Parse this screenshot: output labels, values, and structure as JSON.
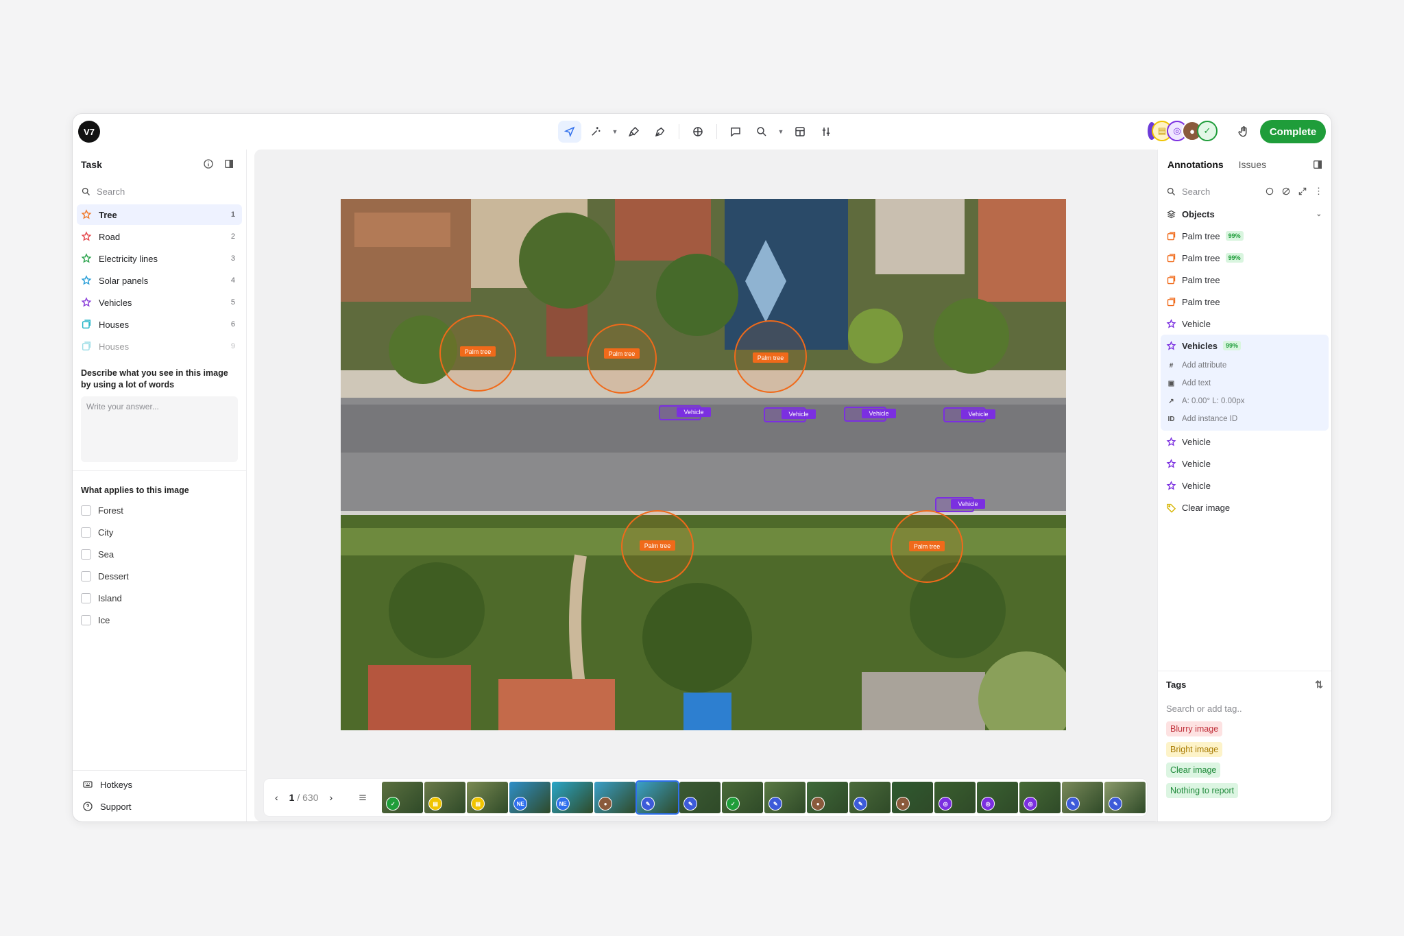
{
  "app": {
    "logo_text": "V7",
    "complete_label": "Complete"
  },
  "toolbar": {
    "tools": [
      {
        "name": "select-tool",
        "icon": "cursor-icon",
        "active": true
      },
      {
        "name": "auto-annotate-tool",
        "icon": "sparkle-icon"
      },
      {
        "name": "brush-tool",
        "icon": "brush-icon"
      },
      {
        "name": "pen-tool",
        "icon": "pen-icon"
      },
      {
        "name": "model-tool",
        "icon": "brain-icon"
      },
      {
        "name": "comment-tool",
        "icon": "comment-icon"
      },
      {
        "name": "zoom-tool",
        "icon": "zoom-icon"
      },
      {
        "name": "layout-tool",
        "icon": "layout-icon"
      },
      {
        "name": "adjust-tool",
        "icon": "sliders-icon"
      }
    ]
  },
  "left": {
    "title": "Task",
    "search_placeholder": "Search",
    "classes": [
      {
        "label": "Tree",
        "count": "1",
        "color": "#f07a2a",
        "selected": true
      },
      {
        "label": "Road",
        "count": "2",
        "color": "#e5484d"
      },
      {
        "label": "Electricity lines",
        "count": "3",
        "color": "#2ea44f"
      },
      {
        "label": "Solar panels",
        "count": "4",
        "color": "#2a9fd8"
      },
      {
        "label": "Vehicles",
        "count": "5",
        "color": "#8b3fd9"
      },
      {
        "label": "Houses",
        "count": "6",
        "color": "#27b6c9"
      },
      {
        "label": "Houses",
        "count": "9",
        "color": "#27b6c9",
        "faded": true
      }
    ],
    "question1": "Describe what you see in this image by using a lot of words",
    "answer_placeholder": "Write your answer...",
    "question2": "What applies to this image",
    "options": [
      "Forest",
      "City",
      "Sea",
      "Dessert",
      "Island",
      "Ice"
    ],
    "footer": [
      {
        "label": "Hotkeys",
        "icon": "keyboard-icon"
      },
      {
        "label": "Support",
        "icon": "help-icon"
      }
    ]
  },
  "canvas": {
    "labels": {
      "palm": "Palm tree",
      "vehicle": "Vehicle"
    },
    "pager": {
      "current": "1",
      "total": "/ 630"
    }
  },
  "right": {
    "tabs": [
      "Annotations",
      "Issues"
    ],
    "search_placeholder": "Search",
    "objects_label": "Objects",
    "annotations": [
      {
        "label": "Palm tree",
        "pct": "99%",
        "kind": "palm"
      },
      {
        "label": "Palm tree",
        "pct": "99%",
        "kind": "palm"
      },
      {
        "label": "Palm tree",
        "kind": "palm"
      },
      {
        "label": "Palm tree",
        "kind": "palm"
      },
      {
        "label": "Vehicle",
        "kind": "vehicle"
      }
    ],
    "selected": {
      "label": "Vehicles",
      "pct": "99%",
      "attrs": [
        "Add attribute",
        "Add text",
        "A: 0.00° L: 0.00px",
        "Add instance ID"
      ]
    },
    "annotations_after": [
      {
        "label": "Vehicle",
        "kind": "vehicle"
      },
      {
        "label": "Vehicle",
        "kind": "vehicle"
      },
      {
        "label": "Vehicle",
        "kind": "vehicle"
      },
      {
        "label": "Clear image",
        "kind": "tag"
      }
    ],
    "tags_title": "Tags",
    "tags_placeholder": "Search or add tag..",
    "tags": [
      {
        "label": "Blurry image",
        "bg": "#fde2e2",
        "fg": "#c0303a"
      },
      {
        "label": "Bright image",
        "bg": "#fdf3c9",
        "fg": "#a87a00"
      },
      {
        "label": "Clear image",
        "bg": "#dcf5e2",
        "fg": "#1f8a3a"
      },
      {
        "label": "Nothing to report",
        "bg": "#dcf5e2",
        "fg": "#1f8a3a"
      }
    ]
  },
  "colors": {
    "accent": "#2f6fed",
    "complete": "#1f9d3a",
    "palm": "#f06a1a",
    "vehicle": "#7b2fe0"
  }
}
